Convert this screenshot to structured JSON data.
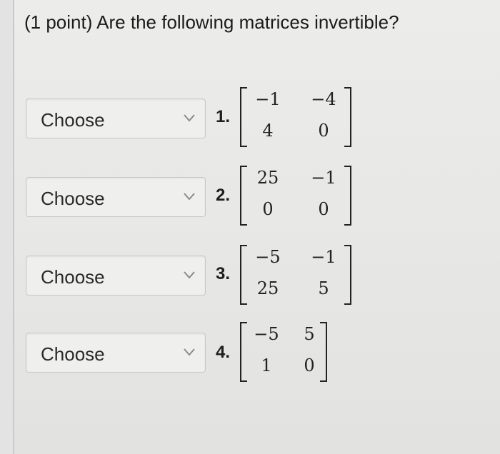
{
  "question": {
    "text": "(1 point) Are the following matrices invertible?"
  },
  "items": [
    {
      "select_label": "Choose",
      "number": "1.",
      "matrix": [
        [
          "−1",
          "−4"
        ],
        [
          "4",
          "0"
        ]
      ]
    },
    {
      "select_label": "Choose",
      "number": "2.",
      "matrix": [
        [
          "25",
          "−1"
        ],
        [
          "0",
          "0"
        ]
      ]
    },
    {
      "select_label": "Choose",
      "number": "3.",
      "matrix": [
        [
          "−5",
          "−1"
        ],
        [
          "25",
          "5"
        ]
      ]
    },
    {
      "select_label": "Choose",
      "number": "4.",
      "matrix": [
        [
          "−5",
          "5"
        ],
        [
          "1",
          "0"
        ]
      ]
    }
  ],
  "icons": {
    "dropdown": "chevron-down-icon"
  }
}
